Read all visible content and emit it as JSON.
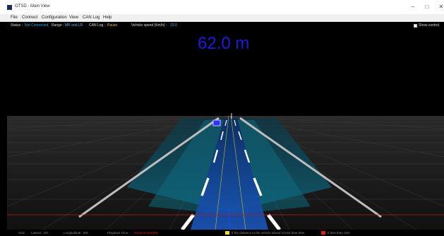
{
  "window": {
    "title": "OTSD - Main View"
  },
  "menu": [
    "File",
    "Connect",
    "Configuration",
    "View",
    "CAN Log",
    "Help"
  ],
  "status": {
    "status_label": "Status :",
    "status_value": "Not Connected",
    "range_label": "Range :",
    "range_value": "MR and LR",
    "canlog_label": "CAN Log :",
    "canlog_value": "Pause",
    "speed_label": "Vehicle speed (Km/h) :",
    "speed_value": "19.0"
  },
  "show_control": {
    "label": "Show control",
    "checked": false
  },
  "distance_readout": "62.0 m",
  "bottom": {
    "grid_label": "Grid",
    "lateral": "Lateral : 1/8",
    "longitudinal": "Longitudinal : 5/8",
    "playback_label": "Playback Time :",
    "playback_value": "00:00:00.000000",
    "legend_yellow": "If the distance to the vehicle ahead is less than 30m",
    "legend_red": "If less than 10m"
  },
  "colors": {
    "accent_blue": "#1a1ae6",
    "legend_yellow": "#f0e020",
    "legend_red": "#d02020"
  }
}
